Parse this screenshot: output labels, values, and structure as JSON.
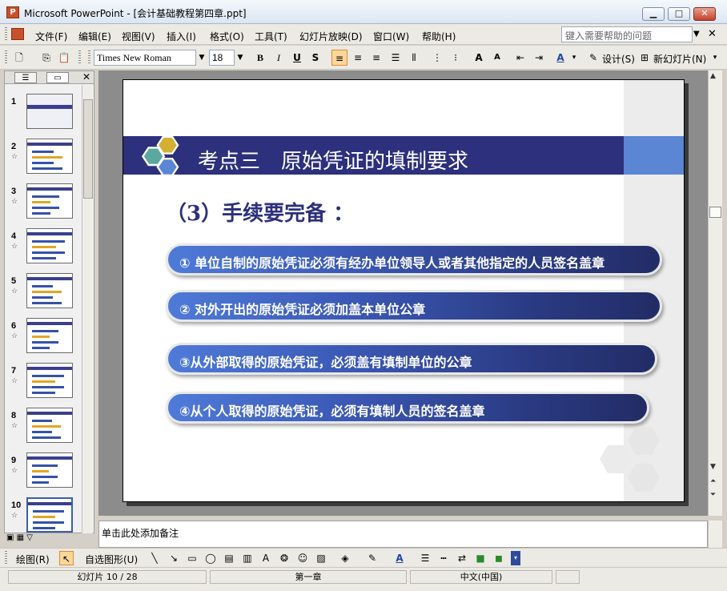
{
  "window": {
    "title": "Microsoft PowerPoint - [会计基础教程第四章.ppt]",
    "minimize": "▁",
    "maximize": "□",
    "close": "✕"
  },
  "menu": {
    "items": [
      "文件(F)",
      "编辑(E)",
      "视图(V)",
      "插入(I)",
      "格式(O)",
      "工具(T)",
      "幻灯片放映(D)",
      "窗口(W)",
      "帮助(H)"
    ],
    "help_placeholder": "键入需要帮助的问题"
  },
  "toolbar": {
    "font_name": "Times New Roman",
    "font_size": "18",
    "bold": "B",
    "italic": "I",
    "underline": "U",
    "shadow": "S",
    "design_label": "设计(S)",
    "new_slide_label": "新幻灯片(N)"
  },
  "slides": {
    "total": 28,
    "current": 10,
    "thumbnails": [
      "1",
      "2",
      "3",
      "4",
      "5",
      "6",
      "7",
      "8",
      "9",
      "10"
    ]
  },
  "slide": {
    "title": "考点三　原始凭证的填制要求",
    "subtitle": "（3）手续要完备 ：",
    "items": [
      "① 单位自制的原始凭证必须有经办单位领导人或者其他指定的人员签名盖章",
      "② 对外开出的原始凭证必须加盖本单位公章",
      "③从外部取得的原始凭证，必须盖有填制单位的公章",
      "④从个人取得的原始凭证，必须有填制人员的签名盖章"
    ],
    "colors": {
      "title_bar": "#2d307c",
      "accent": "#5b86d4",
      "hex_teal": "#5aa8a0",
      "hex_gold": "#d4b032",
      "hex_blue": "#5b86d4"
    }
  },
  "notes": {
    "placeholder": "单击此处添加备注"
  },
  "drawing": {
    "draw_label": "绘图(R)",
    "autoshapes_label": "自选图形(U)"
  },
  "status": {
    "slide_info": "幻灯片 10 / 28",
    "design_name": "第一章",
    "language": "中文(中国)"
  }
}
